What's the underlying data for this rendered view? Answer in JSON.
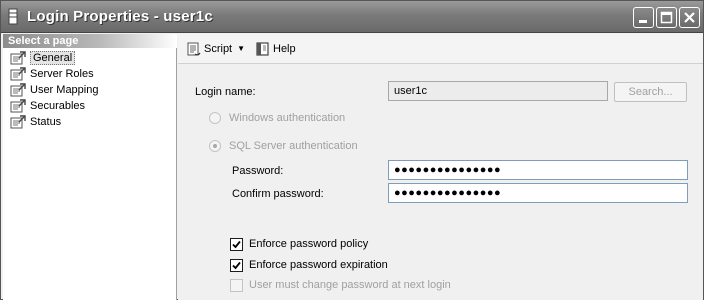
{
  "window": {
    "title": "Login Properties - user1c"
  },
  "left_pane": {
    "header": "Select a page",
    "items": [
      {
        "label": "General",
        "icon": "page-icon",
        "selected": true
      },
      {
        "label": "Server Roles",
        "icon": "page-icon"
      },
      {
        "label": "User Mapping",
        "icon": "page-icon"
      },
      {
        "label": "Securables",
        "icon": "page-icon"
      },
      {
        "label": "Status",
        "icon": "page-icon"
      }
    ]
  },
  "toolbar": {
    "script_label": "Script",
    "help_label": "Help"
  },
  "general": {
    "login_name_label": "Login name:",
    "login_name_value": "user1c",
    "search_button": "Search...",
    "windows_auth_label": "Windows authentication",
    "sql_auth_label": "SQL Server authentication",
    "password_label": "Password:",
    "password_value": "●●●●●●●●●●●●●●●",
    "confirm_password_label": "Confirm password:",
    "confirm_password_value": "●●●●●●●●●●●●●●●",
    "enforce_policy_label": "Enforce password policy",
    "enforce_policy_checked": true,
    "enforce_expiration_label": "Enforce password expiration",
    "enforce_expiration_checked": true,
    "must_change_label": "User must change password at next login",
    "must_change_checked": false
  }
}
